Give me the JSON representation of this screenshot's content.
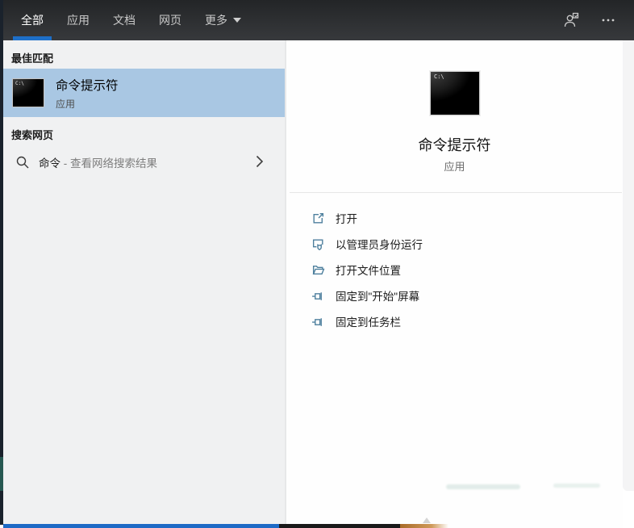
{
  "topbar": {
    "tabs": [
      {
        "label": "全部",
        "selected": true
      },
      {
        "label": "应用",
        "selected": false
      },
      {
        "label": "文档",
        "selected": false
      },
      {
        "label": "网页",
        "selected": false
      }
    ],
    "more_label": "更多",
    "icons": {
      "account": "account-sign-in-options-icon",
      "ellipsis": "more-options-ellipsis-icon"
    }
  },
  "left_panel": {
    "best_match_header": "最佳匹配",
    "best_match": {
      "title": "命令提示符",
      "subtitle": "应用",
      "icon": "command-prompt-icon",
      "icon_text": "C:\\"
    },
    "web_header": "搜索网页",
    "web_row": {
      "query": "命令",
      "hint": " - 查看网络搜索结果",
      "icon": "search-icon"
    }
  },
  "right_panel": {
    "app_icon_text": "C:\\",
    "app_title": "命令提示符",
    "app_subtitle": "应用",
    "actions": [
      {
        "label": "打开",
        "icon": "open-icon"
      },
      {
        "label": "以管理员身份运行",
        "icon": "run-as-admin-icon"
      },
      {
        "label": "打开文件位置",
        "icon": "open-file-location-icon"
      },
      {
        "label": "固定到\"开始\"屏幕",
        "icon": "pin-icon"
      },
      {
        "label": "固定到任务栏",
        "icon": "pin-icon"
      }
    ]
  },
  "colors": {
    "accent_blue": "#1e6fc8",
    "selected_row_blue": "#a9c7e3",
    "topbar_bg": "#2f3235",
    "left_panel_bg": "#f0f1f2",
    "taskbar_blue": "#1d6ac6",
    "taskbar_dark": "#191919",
    "taskbar_orange": "#b5752f",
    "action_icon_teal": "#4d7f9d"
  }
}
